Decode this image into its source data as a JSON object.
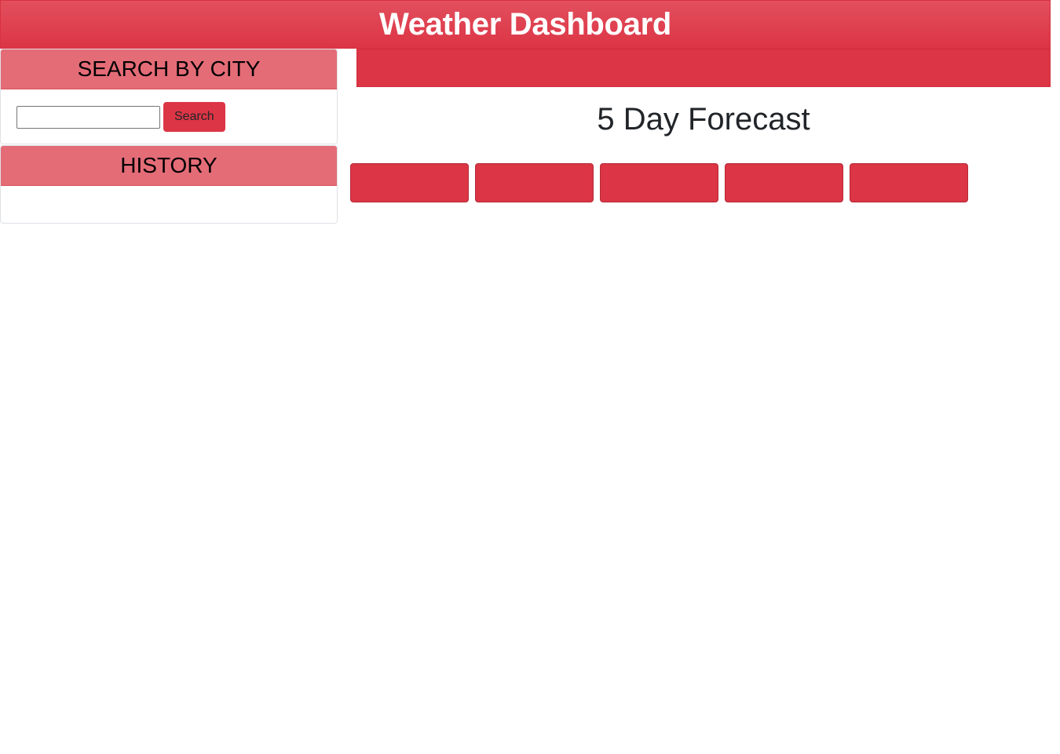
{
  "header": {
    "title": "Weather Dashboard"
  },
  "search": {
    "title": "SEARCH BY CITY",
    "input_value": "",
    "button_label": "Search"
  },
  "history": {
    "title": "HISTORY",
    "items": []
  },
  "current_weather": {},
  "forecast": {
    "title": "5 Day Forecast",
    "days": [
      {},
      {},
      {},
      {},
      {}
    ]
  },
  "colors": {
    "accent": "#dc3545",
    "panel_header": "#e46c77",
    "heading_text": "#212529"
  }
}
